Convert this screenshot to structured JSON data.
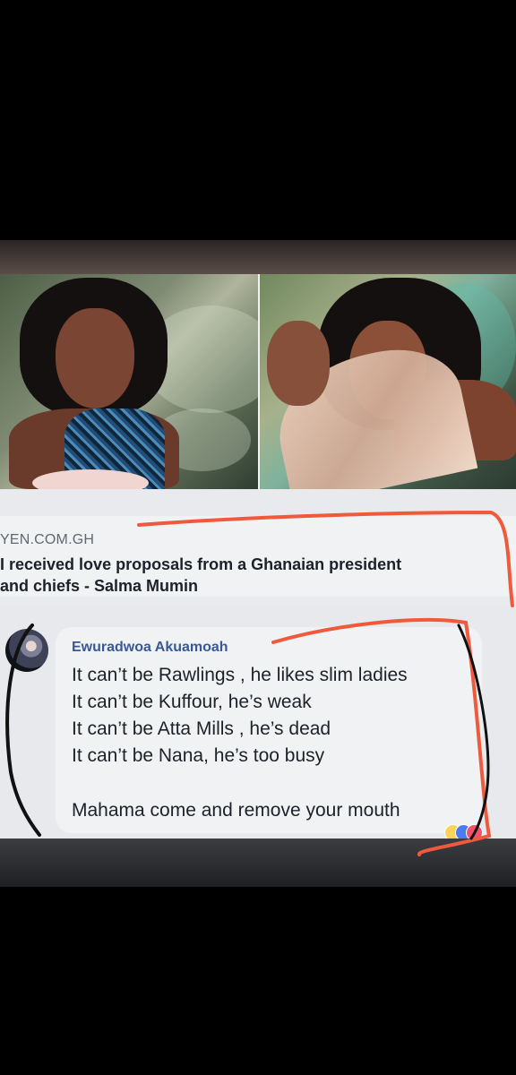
{
  "post": {
    "site": "YEN.COM.GH",
    "headline": "I received love proposals from a Ghanaian president\nand chiefs - Salma Mumin"
  },
  "comment": {
    "author": "Ewuradwoa Akuamoah",
    "lines": [
      "It can’t be Rawlings , he likes slim ladies",
      "It can’t be Kuffour, he’s weak",
      "It can’t be Atta Mills , he’s dead",
      "It can’t be Nana, he’s too busy",
      "Mahama come and remove your mouth"
    ]
  },
  "colors": {
    "annotation": "#f05a3c",
    "author": "#385898",
    "text": "#1d2129"
  },
  "icons": {
    "reaction_1": "laugh-reaction-icon",
    "reaction_2": "like-reaction-icon",
    "reaction_3": "love-reaction-icon"
  }
}
